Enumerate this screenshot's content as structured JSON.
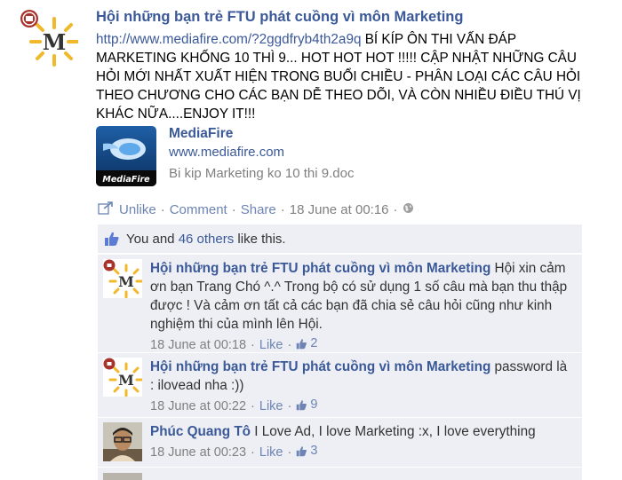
{
  "post": {
    "author": "Hội những bạn trẻ FTU phát cuồng vì môn Marketing",
    "url": "http://www.mediafire.com/?2ggdfryb4th2a9q",
    "text": " BÍ KÍP ÔN THI VẤN ĐÁP MARKETING KHỐNG 10 THÌ 9... HOT HOT HOT !!!!! CẬP NHẬT NHỮNG CÂU HỎI MỚI NHẤT XUẤT HIỆN TRONG BUỔI CHIỀU - PHÂN LOẠI CÁC CÂU HỎI THEO CHƯƠNG CHO CÁC BẠN DỄ THEO DÕI, VÀ CÒN NHIỀU ĐIỀU THÚ VỊ KHÁC NỮA....ENJOY IT!!!",
    "avatar_letter": "M",
    "attachment": {
      "title": "MediaFire",
      "domain": "www.mediafire.com",
      "description": "Bi kip Marketing ko 10 thi 9.doc",
      "logo_text": "MediaFire"
    },
    "actions": {
      "unlike": "Unlike",
      "comment": "Comment",
      "share": "Share",
      "timestamp": "18 June at 00:16",
      "sep": "·"
    },
    "likes": {
      "prefix": "You and ",
      "others": "46 others",
      "suffix": " like this."
    }
  },
  "comments": [
    {
      "author": "Hội những bạn trẻ FTU phát cuồng vì môn Marketing",
      "text": " Hội xin cảm ơn bạn Trang Chó ^.^ Trong bộ có sử dụng 1 số câu mà bạn thu thập được ! Và cảm ơn tất cả các bạn đã chia sẻ câu hỏi cũng như kinh nghiệm thi của mình lên Hội.",
      "time": "18 June at 00:18",
      "like": "Like",
      "like_count": "2"
    },
    {
      "author": "Hội những bạn trẻ FTU phát cuồng vì môn Marketing",
      "text": " password là : ilovead nha :))",
      "time": "18 June at 00:22",
      "like": "Like",
      "like_count": "9"
    },
    {
      "author": "Phúc Quang Tô",
      "text": " I Love Ad, I love Marketing :x, I love everything",
      "time": "18 June at 00:23",
      "like": "Like",
      "like_count": "3"
    }
  ],
  "colors": {
    "link": "#3b5998",
    "muted": "#808080",
    "comment_bg": "#edeff4",
    "logo_gold": "#f0b82a"
  }
}
